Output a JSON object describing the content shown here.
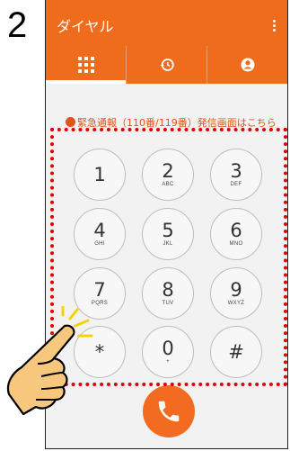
{
  "step_number": "2",
  "app": {
    "title": "ダイヤル",
    "accent_color": "#ef6c1d"
  },
  "tabs": [
    {
      "icon": "dialpad-icon",
      "active": true
    },
    {
      "icon": "history-icon",
      "active": false
    },
    {
      "icon": "contacts-icon",
      "active": false
    }
  ],
  "emergency_link": "緊急通報（110番/119番）発信画面はこちら",
  "keys": [
    {
      "num": "1",
      "sub": ""
    },
    {
      "num": "2",
      "sub": "ABC"
    },
    {
      "num": "3",
      "sub": "DEF"
    },
    {
      "num": "4",
      "sub": "GHI"
    },
    {
      "num": "5",
      "sub": "JKL"
    },
    {
      "num": "6",
      "sub": "MNO"
    },
    {
      "num": "7",
      "sub": "PQRS"
    },
    {
      "num": "8",
      "sub": "TUV"
    },
    {
      "num": "9",
      "sub": "WXYZ"
    },
    {
      "num": "*",
      "sub": ""
    },
    {
      "num": "0",
      "sub": "+"
    },
    {
      "num": "#",
      "sub": ""
    }
  ],
  "call_button_color": "#f36b21",
  "highlight_color": "#e00000"
}
